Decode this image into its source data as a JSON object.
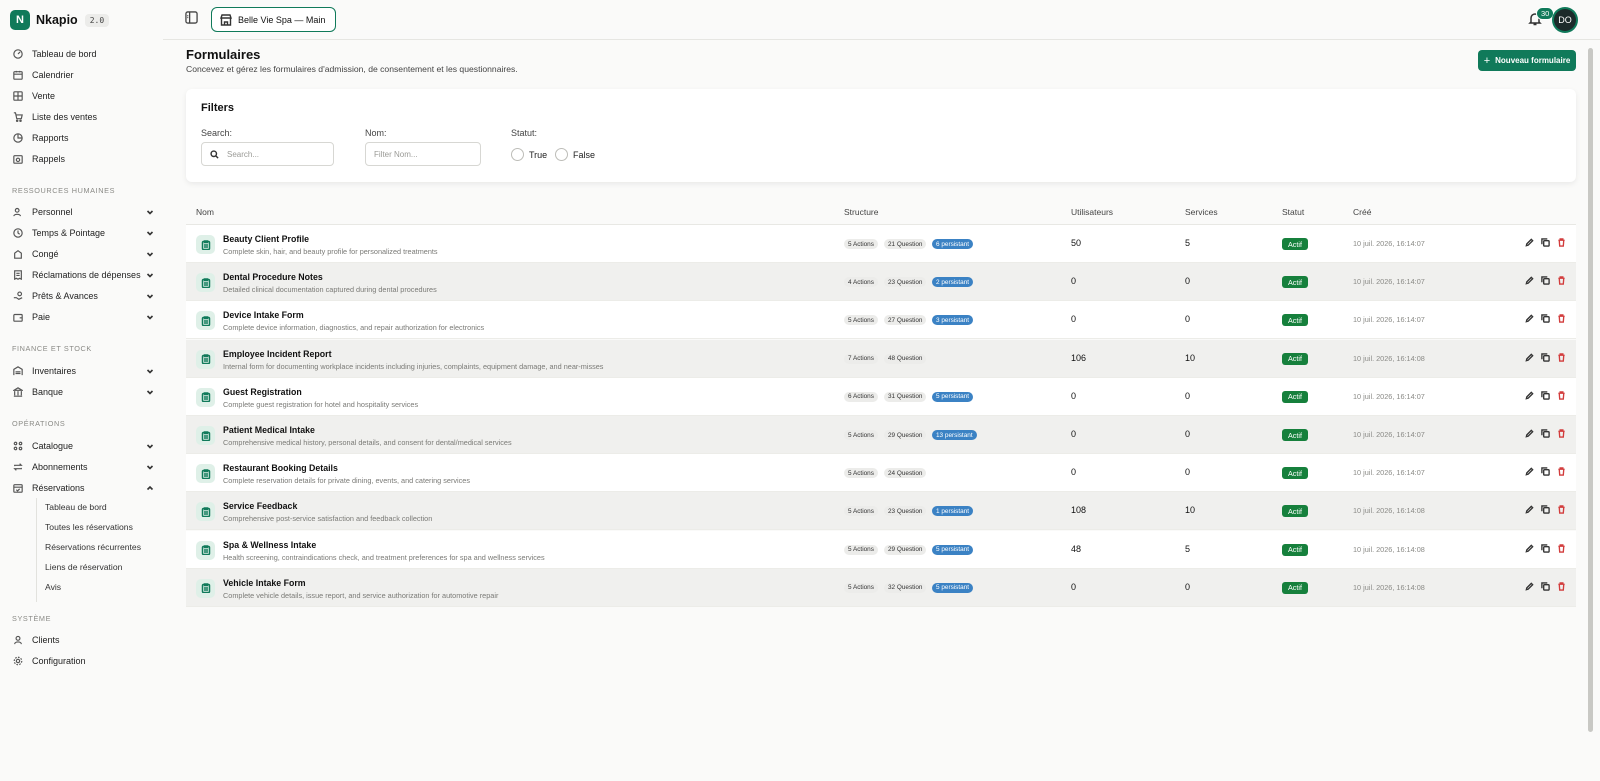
{
  "brand": {
    "name": "Nkapio",
    "version": "2.0",
    "logo_letter": "N",
    "accent": "#107a5a"
  },
  "sidebar": {
    "main_items": [
      {
        "label": "Tableau de bord",
        "icon": "dashboard-icon"
      },
      {
        "label": "Calendrier",
        "icon": "calendar-icon"
      },
      {
        "label": "Vente",
        "icon": "grid-icon"
      },
      {
        "label": "Liste des ventes",
        "icon": "cart-icon"
      },
      {
        "label": "Rapports",
        "icon": "pie-chart-icon"
      },
      {
        "label": "Rappels",
        "icon": "reminder-icon"
      }
    ],
    "sections": [
      {
        "title": "RESSOURCES HUMAINES",
        "items": [
          {
            "label": "Personnel",
            "icon": "users-icon"
          },
          {
            "label": "Temps & Pointage",
            "icon": "clock-icon"
          },
          {
            "label": "Congé",
            "icon": "leave-icon"
          },
          {
            "label": "Réclamations de dépenses",
            "icon": "receipt-icon"
          },
          {
            "label": "Prêts & Avances",
            "icon": "hand-coins-icon"
          },
          {
            "label": "Paie",
            "icon": "wallet-icon"
          }
        ]
      },
      {
        "title": "FINANCE ET STOCK",
        "items": [
          {
            "label": "Inventaires",
            "icon": "warehouse-icon"
          },
          {
            "label": "Banque",
            "icon": "bank-icon"
          }
        ]
      },
      {
        "title": "OPÉRATIONS",
        "items": [
          {
            "label": "Catalogue",
            "icon": "catalog-icon"
          },
          {
            "label": "Abonnements",
            "icon": "repeat-icon"
          },
          {
            "label": "Réservations",
            "icon": "calendar-check-icon"
          }
        ]
      },
      {
        "title": "SYSTÈME",
        "items": [
          {
            "label": "Clients",
            "icon": "user-icon"
          },
          {
            "label": "Configuration",
            "icon": "gear-icon"
          }
        ]
      }
    ],
    "reservations_sub": [
      "Tableau de bord",
      "Toutes les réservations",
      "Réservations récurrentes",
      "Liens de réservation",
      "Avis"
    ]
  },
  "topbar": {
    "store": "Belle Vie Spa — Main",
    "notifications": "30",
    "avatar": "DO"
  },
  "header": {
    "title": "Formulaires",
    "subtitle": "Concevez et gérez les formulaires d'admission, de consentement et les questionnaires.",
    "new_button": "Nouveau formulaire"
  },
  "filters": {
    "title": "Filters",
    "search_label": "Search:",
    "search_placeholder": "Search...",
    "name_label": "Nom:",
    "name_placeholder": "Filter Nom...",
    "status_label": "Statut:",
    "true_label": "True",
    "false_label": "False"
  },
  "table": {
    "columns": [
      "Nom",
      "Structure",
      "Utilisateurs",
      "Services",
      "Statut",
      "Créé"
    ],
    "rows": [
      {
        "name": "Beauty Client Profile",
        "desc": "Complete skin, hair, and beauty profile for personalized treatments",
        "actions": "5 Actions",
        "questions": "21 Question",
        "persistant": "6 persistant",
        "users": "50",
        "services": "5",
        "status": "Actif",
        "created": "10 juil. 2026, 16:14:07"
      },
      {
        "name": "Dental Procedure Notes",
        "desc": "Detailed clinical documentation captured during dental procedures",
        "actions": "4 Actions",
        "questions": "23 Question",
        "persistant": "2 persistant",
        "users": "0",
        "services": "0",
        "status": "Actif",
        "created": "10 juil. 2026, 16:14:07"
      },
      {
        "name": "Device Intake Form",
        "desc": "Complete device information, diagnostics, and repair authorization for electronics",
        "actions": "5 Actions",
        "questions": "27 Question",
        "persistant": "3 persistant",
        "users": "0",
        "services": "0",
        "status": "Actif",
        "created": "10 juil. 2026, 16:14:07"
      },
      {
        "name": "Employee Incident Report",
        "desc": "Internal form for documenting workplace incidents including injuries, complaints, equipment damage, and near-misses",
        "actions": "7 Actions",
        "questions": "48 Question",
        "persistant": "",
        "users": "106",
        "services": "10",
        "status": "Actif",
        "created": "10 juil. 2026, 16:14:08"
      },
      {
        "name": "Guest Registration",
        "desc": "Complete guest registration for hotel and hospitality services",
        "actions": "6 Actions",
        "questions": "31 Question",
        "persistant": "5 persistant",
        "users": "0",
        "services": "0",
        "status": "Actif",
        "created": "10 juil. 2026, 16:14:07"
      },
      {
        "name": "Patient Medical Intake",
        "desc": "Comprehensive medical history, personal details, and consent for dental/medical services",
        "actions": "5 Actions",
        "questions": "29 Question",
        "persistant": "13 persistant",
        "users": "0",
        "services": "0",
        "status": "Actif",
        "created": "10 juil. 2026, 16:14:07"
      },
      {
        "name": "Restaurant Booking Details",
        "desc": "Complete reservation details for private dining, events, and catering services",
        "actions": "5 Actions",
        "questions": "24 Question",
        "persistant": "",
        "users": "0",
        "services": "0",
        "status": "Actif",
        "created": "10 juil. 2026, 16:14:07"
      },
      {
        "name": "Service Feedback",
        "desc": "Comprehensive post-service satisfaction and feedback collection",
        "actions": "5 Actions",
        "questions": "23 Question",
        "persistant": "1 persistant",
        "users": "108",
        "services": "10",
        "status": "Actif",
        "created": "10 juil. 2026, 16:14:08"
      },
      {
        "name": "Spa & Wellness Intake",
        "desc": "Health screening, contraindications check, and treatment preferences for spa and wellness services",
        "actions": "5 Actions",
        "questions": "29 Question",
        "persistant": "5 persistant",
        "users": "48",
        "services": "5",
        "status": "Actif",
        "created": "10 juil. 2026, 16:14:08"
      },
      {
        "name": "Vehicle Intake Form",
        "desc": "Complete vehicle details, issue report, and service authorization for automotive repair",
        "actions": "5 Actions",
        "questions": "32 Question",
        "persistant": "5 persistant",
        "users": "0",
        "services": "0",
        "status": "Actif",
        "created": "10 juil. 2026, 16:14:08"
      }
    ]
  }
}
